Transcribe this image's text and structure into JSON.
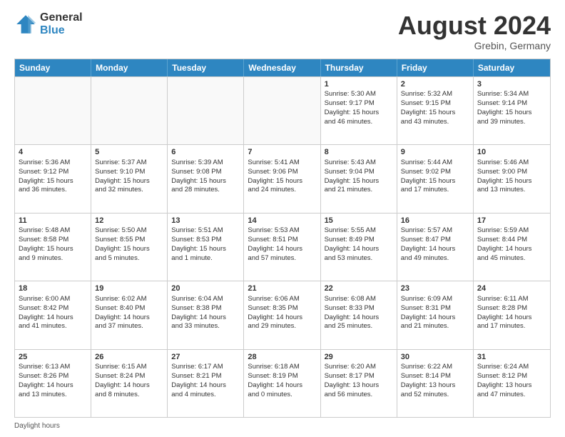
{
  "header": {
    "logo_general": "General",
    "logo_blue": "Blue",
    "month_year": "August 2024",
    "location": "Grebin, Germany"
  },
  "days_of_week": [
    "Sunday",
    "Monday",
    "Tuesday",
    "Wednesday",
    "Thursday",
    "Friday",
    "Saturday"
  ],
  "footer": {
    "daylight_hours": "Daylight hours"
  },
  "weeks": [
    [
      {
        "day": "",
        "info": "",
        "empty": true
      },
      {
        "day": "",
        "info": "",
        "empty": true
      },
      {
        "day": "",
        "info": "",
        "empty": true
      },
      {
        "day": "",
        "info": "",
        "empty": true
      },
      {
        "day": "1",
        "info": "Sunrise: 5:30 AM\nSunset: 9:17 PM\nDaylight: 15 hours\nand 46 minutes.",
        "empty": false
      },
      {
        "day": "2",
        "info": "Sunrise: 5:32 AM\nSunset: 9:15 PM\nDaylight: 15 hours\nand 43 minutes.",
        "empty": false
      },
      {
        "day": "3",
        "info": "Sunrise: 5:34 AM\nSunset: 9:14 PM\nDaylight: 15 hours\nand 39 minutes.",
        "empty": false
      }
    ],
    [
      {
        "day": "4",
        "info": "Sunrise: 5:36 AM\nSunset: 9:12 PM\nDaylight: 15 hours\nand 36 minutes.",
        "empty": false
      },
      {
        "day": "5",
        "info": "Sunrise: 5:37 AM\nSunset: 9:10 PM\nDaylight: 15 hours\nand 32 minutes.",
        "empty": false
      },
      {
        "day": "6",
        "info": "Sunrise: 5:39 AM\nSunset: 9:08 PM\nDaylight: 15 hours\nand 28 minutes.",
        "empty": false
      },
      {
        "day": "7",
        "info": "Sunrise: 5:41 AM\nSunset: 9:06 PM\nDaylight: 15 hours\nand 24 minutes.",
        "empty": false
      },
      {
        "day": "8",
        "info": "Sunrise: 5:43 AM\nSunset: 9:04 PM\nDaylight: 15 hours\nand 21 minutes.",
        "empty": false
      },
      {
        "day": "9",
        "info": "Sunrise: 5:44 AM\nSunset: 9:02 PM\nDaylight: 15 hours\nand 17 minutes.",
        "empty": false
      },
      {
        "day": "10",
        "info": "Sunrise: 5:46 AM\nSunset: 9:00 PM\nDaylight: 15 hours\nand 13 minutes.",
        "empty": false
      }
    ],
    [
      {
        "day": "11",
        "info": "Sunrise: 5:48 AM\nSunset: 8:58 PM\nDaylight: 15 hours\nand 9 minutes.",
        "empty": false
      },
      {
        "day": "12",
        "info": "Sunrise: 5:50 AM\nSunset: 8:55 PM\nDaylight: 15 hours\nand 5 minutes.",
        "empty": false
      },
      {
        "day": "13",
        "info": "Sunrise: 5:51 AM\nSunset: 8:53 PM\nDaylight: 15 hours\nand 1 minute.",
        "empty": false
      },
      {
        "day": "14",
        "info": "Sunrise: 5:53 AM\nSunset: 8:51 PM\nDaylight: 14 hours\nand 57 minutes.",
        "empty": false
      },
      {
        "day": "15",
        "info": "Sunrise: 5:55 AM\nSunset: 8:49 PM\nDaylight: 14 hours\nand 53 minutes.",
        "empty": false
      },
      {
        "day": "16",
        "info": "Sunrise: 5:57 AM\nSunset: 8:47 PM\nDaylight: 14 hours\nand 49 minutes.",
        "empty": false
      },
      {
        "day": "17",
        "info": "Sunrise: 5:59 AM\nSunset: 8:44 PM\nDaylight: 14 hours\nand 45 minutes.",
        "empty": false
      }
    ],
    [
      {
        "day": "18",
        "info": "Sunrise: 6:00 AM\nSunset: 8:42 PM\nDaylight: 14 hours\nand 41 minutes.",
        "empty": false
      },
      {
        "day": "19",
        "info": "Sunrise: 6:02 AM\nSunset: 8:40 PM\nDaylight: 14 hours\nand 37 minutes.",
        "empty": false
      },
      {
        "day": "20",
        "info": "Sunrise: 6:04 AM\nSunset: 8:38 PM\nDaylight: 14 hours\nand 33 minutes.",
        "empty": false
      },
      {
        "day": "21",
        "info": "Sunrise: 6:06 AM\nSunset: 8:35 PM\nDaylight: 14 hours\nand 29 minutes.",
        "empty": false
      },
      {
        "day": "22",
        "info": "Sunrise: 6:08 AM\nSunset: 8:33 PM\nDaylight: 14 hours\nand 25 minutes.",
        "empty": false
      },
      {
        "day": "23",
        "info": "Sunrise: 6:09 AM\nSunset: 8:31 PM\nDaylight: 14 hours\nand 21 minutes.",
        "empty": false
      },
      {
        "day": "24",
        "info": "Sunrise: 6:11 AM\nSunset: 8:28 PM\nDaylight: 14 hours\nand 17 minutes.",
        "empty": false
      }
    ],
    [
      {
        "day": "25",
        "info": "Sunrise: 6:13 AM\nSunset: 8:26 PM\nDaylight: 14 hours\nand 13 minutes.",
        "empty": false
      },
      {
        "day": "26",
        "info": "Sunrise: 6:15 AM\nSunset: 8:24 PM\nDaylight: 14 hours\nand 8 minutes.",
        "empty": false
      },
      {
        "day": "27",
        "info": "Sunrise: 6:17 AM\nSunset: 8:21 PM\nDaylight: 14 hours\nand 4 minutes.",
        "empty": false
      },
      {
        "day": "28",
        "info": "Sunrise: 6:18 AM\nSunset: 8:19 PM\nDaylight: 14 hours\nand 0 minutes.",
        "empty": false
      },
      {
        "day": "29",
        "info": "Sunrise: 6:20 AM\nSunset: 8:17 PM\nDaylight: 13 hours\nand 56 minutes.",
        "empty": false
      },
      {
        "day": "30",
        "info": "Sunrise: 6:22 AM\nSunset: 8:14 PM\nDaylight: 13 hours\nand 52 minutes.",
        "empty": false
      },
      {
        "day": "31",
        "info": "Sunrise: 6:24 AM\nSunset: 8:12 PM\nDaylight: 13 hours\nand 47 minutes.",
        "empty": false
      }
    ]
  ]
}
